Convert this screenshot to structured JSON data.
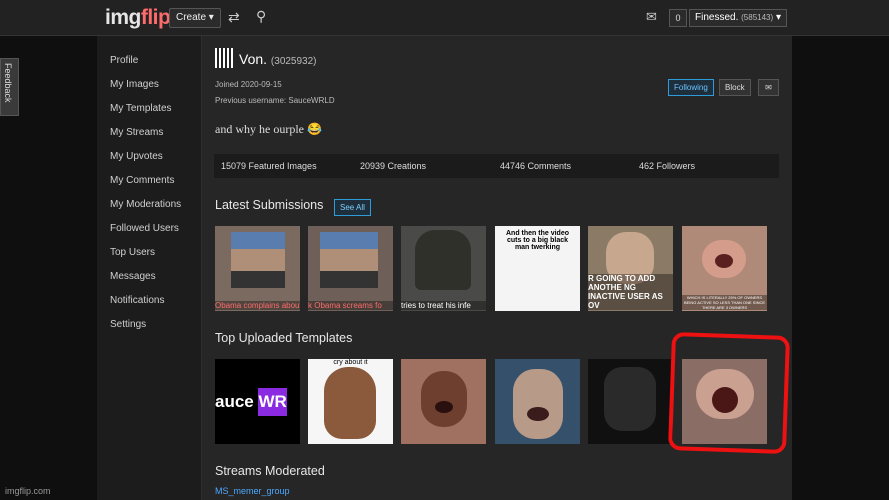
{
  "header": {
    "logo_a": "img",
    "logo_b": "flip",
    "create_label": "Create ▾",
    "notifications_count": "0",
    "user_name": "Finessed.",
    "user_points": "(585143)",
    "user_caret": "▾"
  },
  "feedback_label": "Feedback",
  "sidebar": {
    "items": [
      {
        "label": "Profile"
      },
      {
        "label": "My Images"
      },
      {
        "label": "My Templates"
      },
      {
        "label": "My Streams"
      },
      {
        "label": "My Upvotes"
      },
      {
        "label": "My Comments"
      },
      {
        "label": "My Moderations"
      },
      {
        "label": "Followed Users"
      },
      {
        "label": "Top Users"
      },
      {
        "label": "Messages"
      },
      {
        "label": "Notifications"
      },
      {
        "label": "Settings"
      }
    ]
  },
  "profile": {
    "name": "Von.",
    "id": "(3025932)",
    "joined": "Joined 2020-09-15",
    "previous": "Previous username: SauceWRLD",
    "bio": "and why he ourple 😂",
    "following_label": "Following",
    "block_label": "Block"
  },
  "stats": {
    "featured": "15079 Featured Images",
    "creations": "20939 Creations",
    "comments": "44746 Comments",
    "followers": "462 Followers"
  },
  "latest": {
    "title": "Latest Submissions",
    "see_all": "See All",
    "items": [
      {
        "caption": "Obama complains about"
      },
      {
        "caption": "k Obama screams fo"
      },
      {
        "caption": "tries to treat his infe"
      },
      {
        "caption": "And then the video cuts to a big black man twerking"
      },
      {
        "caption": "R GOING TO ADD ANOTHE NG INACTIVE USER AS OV"
      },
      {
        "caption": "WHICH IS LITERALLY 25% OF OWNERS BEING ACTIVE SO LESS THAN ONE SINCE THERE ARE 3 OWNERS"
      }
    ]
  },
  "templates": {
    "title": "Top Uploaded Templates",
    "items": [
      {
        "caption": "auce WR"
      },
      {
        "caption": "cry about it"
      },
      {
        "caption": ""
      },
      {
        "caption": ""
      },
      {
        "caption": ""
      },
      {
        "caption": ""
      }
    ]
  },
  "streams": {
    "title": "Streams Moderated",
    "link": "MS_memer_group"
  },
  "watermark": "imgflip.com",
  "colors": {
    "accent": "#2f9bd9",
    "highlight": "#e11111"
  }
}
